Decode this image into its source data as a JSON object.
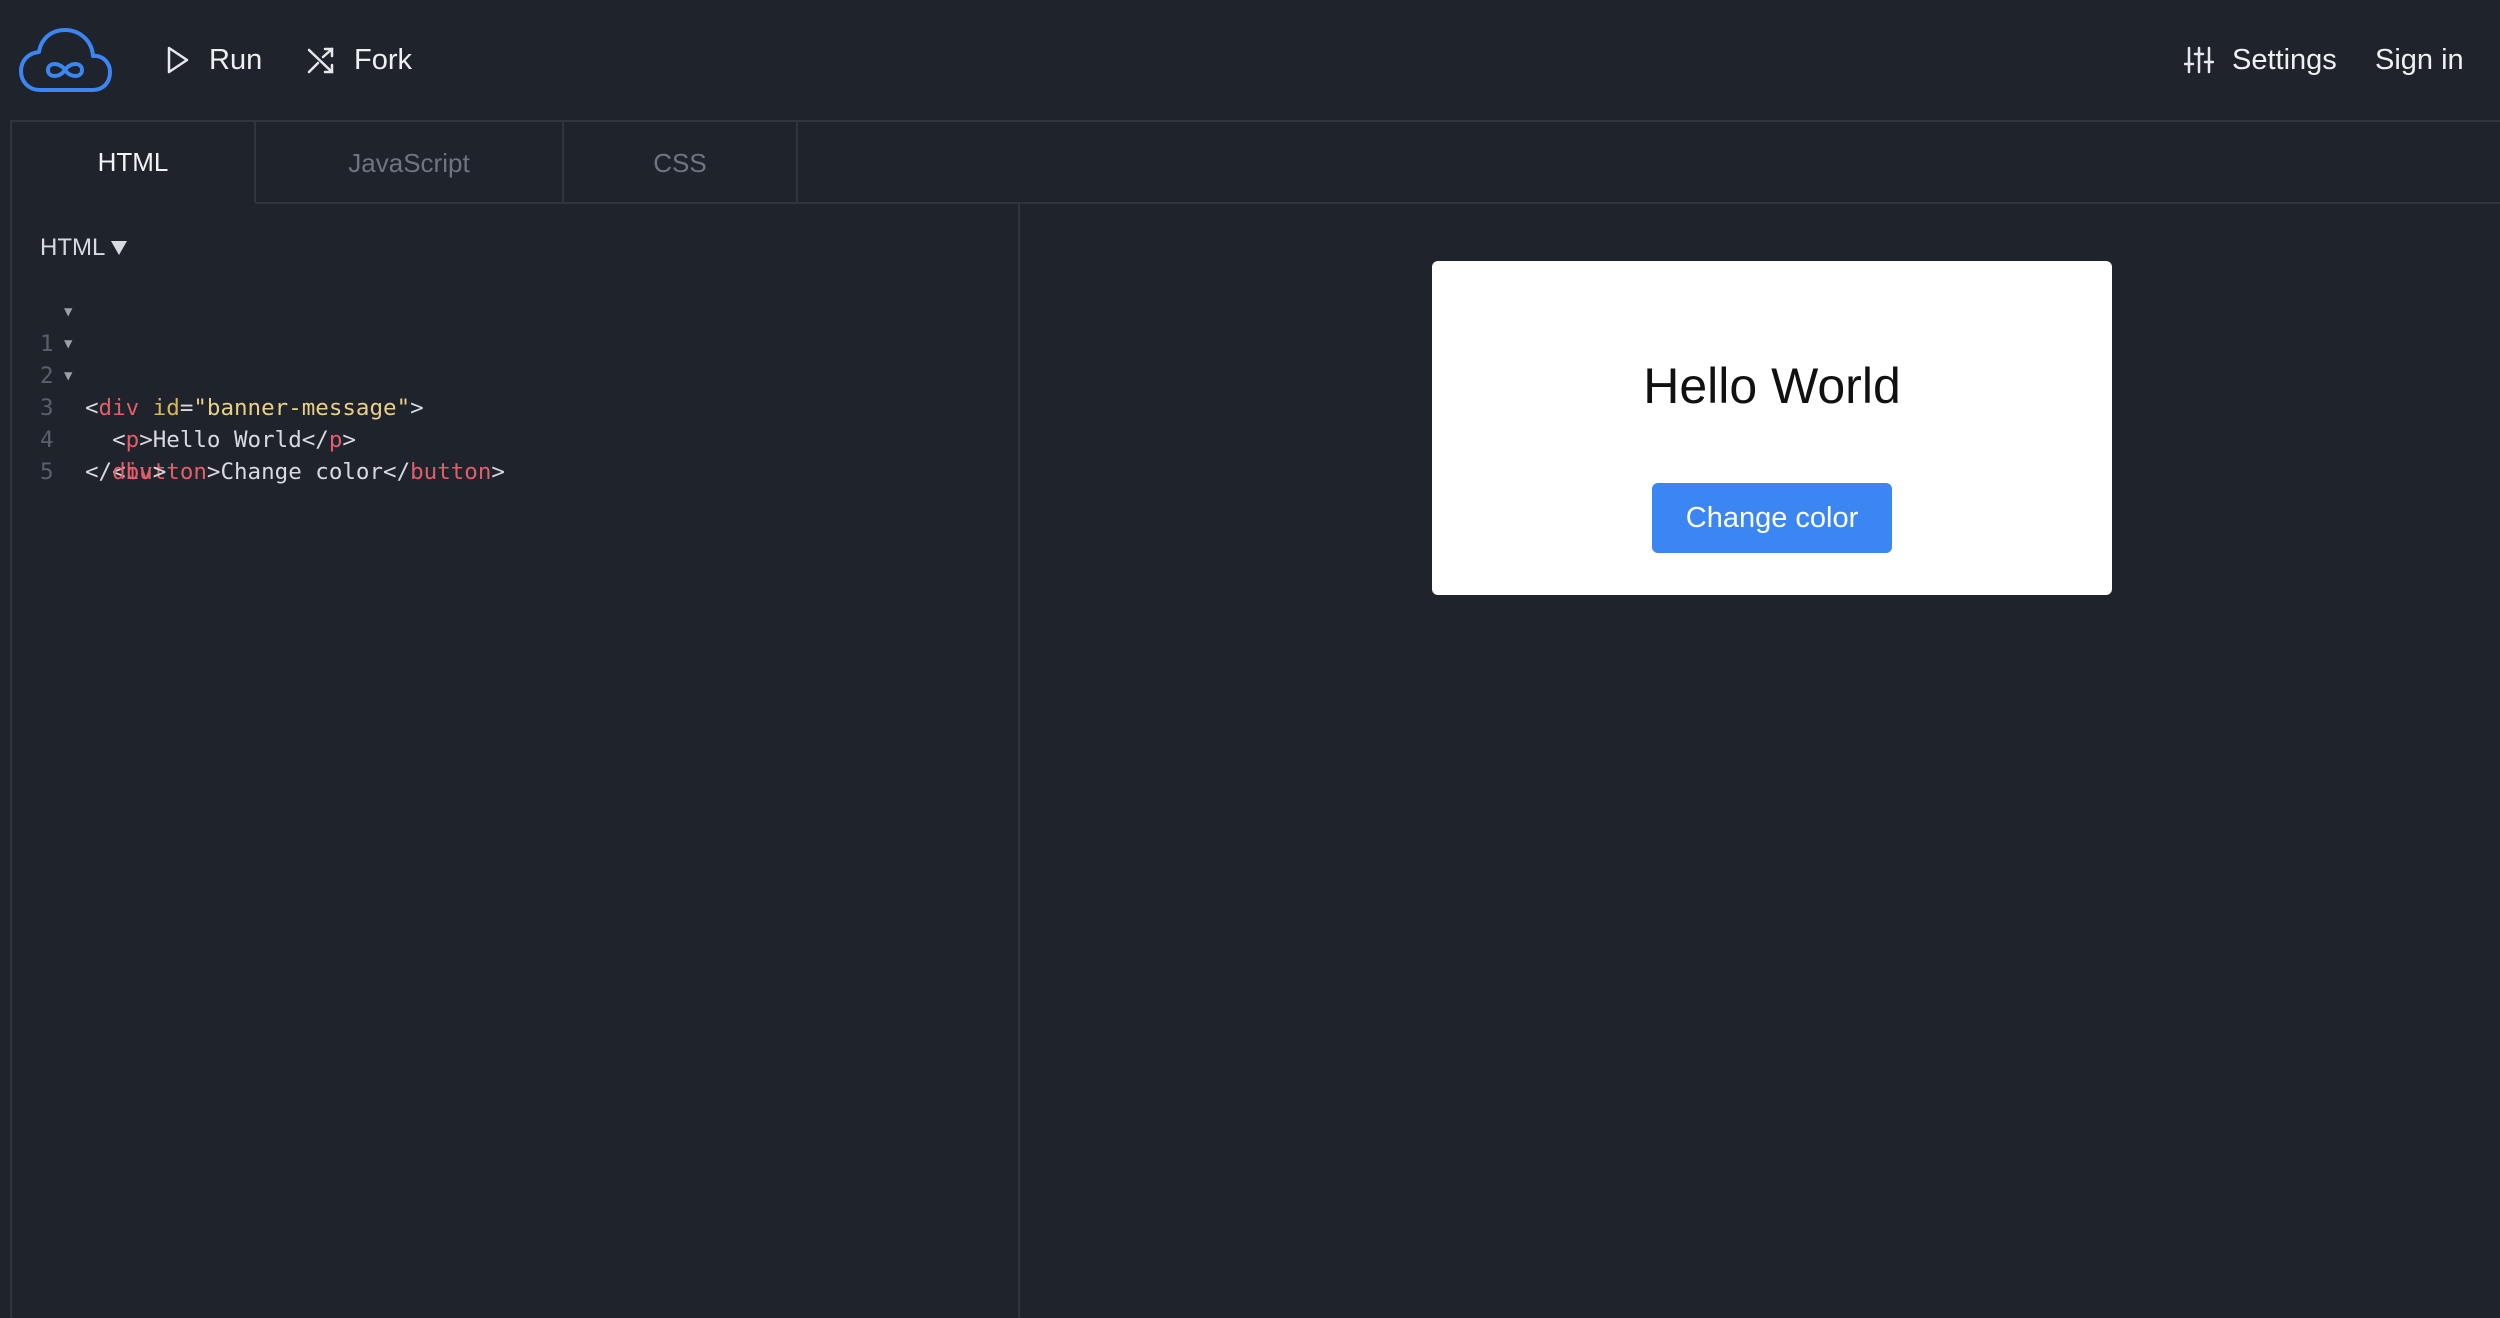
{
  "toolbar": {
    "run_label": "Run",
    "fork_label": "Fork",
    "settings_label": "Settings",
    "signin_label": "Sign in",
    "logo_icon": "cloud-infinity-logo",
    "accent": "#3b86f3"
  },
  "tabs": [
    {
      "label": "HTML",
      "active": true
    },
    {
      "label": "JavaScript",
      "active": false
    },
    {
      "label": "CSS",
      "active": false
    }
  ],
  "editor": {
    "language": "HTML",
    "lines": [
      {
        "num": "1",
        "folding": true
      },
      {
        "num": "2",
        "folding": true
      },
      {
        "num": "3",
        "folding": true
      },
      {
        "num": "4",
        "folding": false
      },
      {
        "num": "5",
        "folding": false
      }
    ],
    "code": {
      "line1": {
        "open": "<",
        "tag": "div",
        "attr": "id",
        "eq": "=",
        "value": "\"banner-message\"",
        "close": ">"
      },
      "line2": {
        "open": "<",
        "tag": "p",
        "close": ">",
        "text": "Hello World",
        "end_open": "</",
        "end_tag": "p",
        "end_close": ">"
      },
      "line3": {
        "open": "<",
        "tag": "button",
        "close": ">",
        "text": "Change color",
        "end_open": "</",
        "end_tag": "button",
        "end_close": ">"
      },
      "line4": {
        "end_open": "</",
        "end_tag": "div",
        "end_close": ">"
      }
    }
  },
  "preview": {
    "message": "Hello World",
    "button_label": "Change color",
    "button_color": "#3b86f3"
  }
}
